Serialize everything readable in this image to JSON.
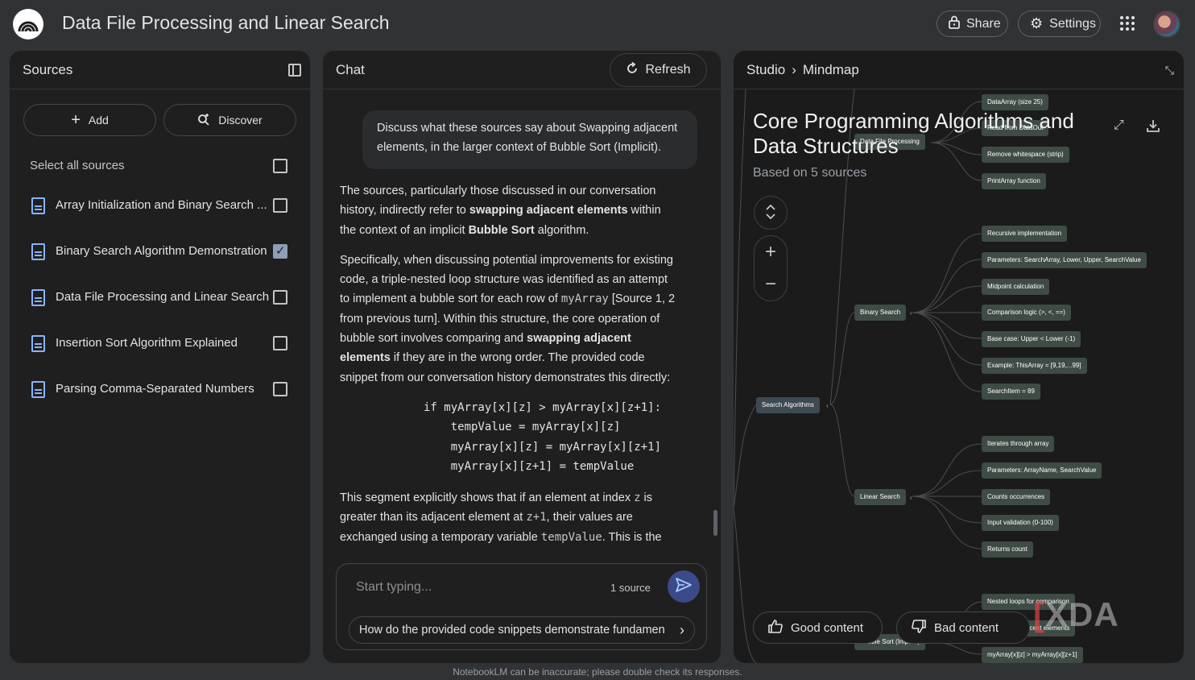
{
  "app": {
    "title": "Data File Processing and Linear Search",
    "share_label": "Share",
    "settings_label": "Settings"
  },
  "sources": {
    "title": "Sources",
    "add_label": "Add",
    "discover_label": "Discover",
    "select_all_label": "Select all sources",
    "items": [
      {
        "label": "Array Initialization and Binary Search ...",
        "checked": false
      },
      {
        "label": "Binary Search Algorithm Demonstration",
        "checked": true
      },
      {
        "label": "Data File Processing and Linear Search",
        "checked": false
      },
      {
        "label": "Insertion Sort Algorithm Explained",
        "checked": false
      },
      {
        "label": "Parsing Comma-Separated Numbers",
        "checked": false
      }
    ]
  },
  "chat": {
    "title": "Chat",
    "refresh_label": "Refresh",
    "user_message": "Discuss what these sources say about Swapping adjacent elements, in the larger context of Bubble Sort (Implicit).",
    "p1_a": "The sources, particularly those discussed in our conversation history, indirectly refer to ",
    "p1_b": "swapping adjacent elements",
    "p1_c": " within the context of an implicit ",
    "p1_d": "Bubble Sort",
    "p1_e": " algorithm.",
    "p2_a": "Specifically, when discussing potential improvements for existing code, a triple-nested loop structure was identified as an attempt to implement a bubble sort for each row of ",
    "p2_b": "myArray",
    "p2_c": " [Source 1, 2 from previous turn]. Within this structure, the core operation of bubble sort involves comparing and ",
    "p2_d": "swapping adjacent elements",
    "p2_e": " if they are in the wrong order. The provided code snippet from our conversation history demonstrates this directly:",
    "code": "if myArray[x][z] > myArray[x][z+1]:\n    tempValue = myArray[x][z]\n    myArray[x][z] = myArray[x][z+1]\n    myArray[x][z+1] = tempValue",
    "p3_a": "This segment explicitly shows that if an element at index ",
    "p3_b": "z",
    "p3_c": " is greater than its adjacent element at ",
    "p3_d": "z+1",
    "p3_e": ", their values are exchanged using a temporary variable ",
    "p3_f": "tempValue",
    "p3_g": ". This is the",
    "input_placeholder": "Start typing...",
    "source_count": "1 source",
    "suggestion": "How do the provided code snippets demonstrate fundamen"
  },
  "studio": {
    "breadcrumb_root": "Studio",
    "breadcrumb_sep": "›",
    "breadcrumb_page": "Mindmap",
    "mindmap_title": "Core Programming Algorithms and Data Structures",
    "mindmap_subtitle": "Based on 5 sources",
    "good_label": "Good content",
    "bad_label": "Bad content",
    "watermark": "XDA",
    "nodes": {
      "dataarray": "DataArray (size 25)",
      "read_from": "Read from DataOut",
      "data_file": "Data File Processing",
      "remove_ws": "Remove whitespace (strip)",
      "printarray": "PrintArray function",
      "recursive": "Recursive implementation",
      "params_bs": "Parameters: SearchArray, Lower, Upper, SearchValue",
      "midpoint": "Midpoint calculation",
      "comparison": "Comparison logic (>, <, ==)",
      "basecase": "Base case: Upper < Lower (-1)",
      "example": "Example: ThisArray = [9,19,...99]",
      "searchitem": "SearchItem = 89",
      "binary": "Binary Search",
      "search_algos": "Search Algorithms",
      "iterates": "Iterates through array",
      "params_ls": "Parameters: ArrayName, SearchValue",
      "counts": "Counts occurrences",
      "validation": "Input validation (0-100)",
      "returns": "Returns count",
      "linear": "Linear Search",
      "nested": "Nested loops for comparison",
      "adjacent": "Swapping adjacent elements",
      "bubble": "Bubble Sort (Implicit)",
      "condition": "myArray[x][z] > myArray[x][z+1]"
    }
  },
  "disclaimer": "NotebookLM can be inaccurate; please double check its responses."
}
